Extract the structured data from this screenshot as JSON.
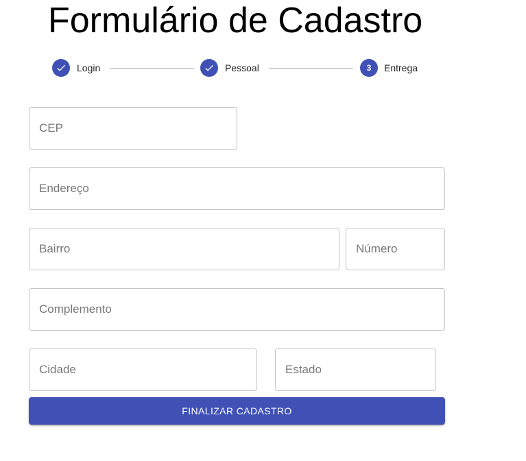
{
  "header": {
    "title": "Formulário de Cadastro"
  },
  "stepper": {
    "steps": [
      {
        "label": "Login",
        "state": "completed",
        "icon": "check-icon"
      },
      {
        "label": "Pessoal",
        "state": "completed",
        "icon": "check-icon"
      },
      {
        "label": "Entrega",
        "state": "active",
        "number": "3"
      }
    ]
  },
  "form": {
    "cep": {
      "placeholder": "CEP",
      "value": ""
    },
    "endereco": {
      "placeholder": "Endereço",
      "value": ""
    },
    "bairro": {
      "placeholder": "Bairro",
      "value": ""
    },
    "numero": {
      "placeholder": "Número",
      "value": ""
    },
    "complemento": {
      "placeholder": "Complemento",
      "value": ""
    },
    "cidade": {
      "placeholder": "Cidade",
      "value": ""
    },
    "estado": {
      "placeholder": "Estado",
      "value": ""
    },
    "submit_label": "FINALIZAR CADASTRO"
  },
  "colors": {
    "primary": "#3f51b5",
    "field_border": "#c4c4c4",
    "connector": "#bdbdbd"
  }
}
